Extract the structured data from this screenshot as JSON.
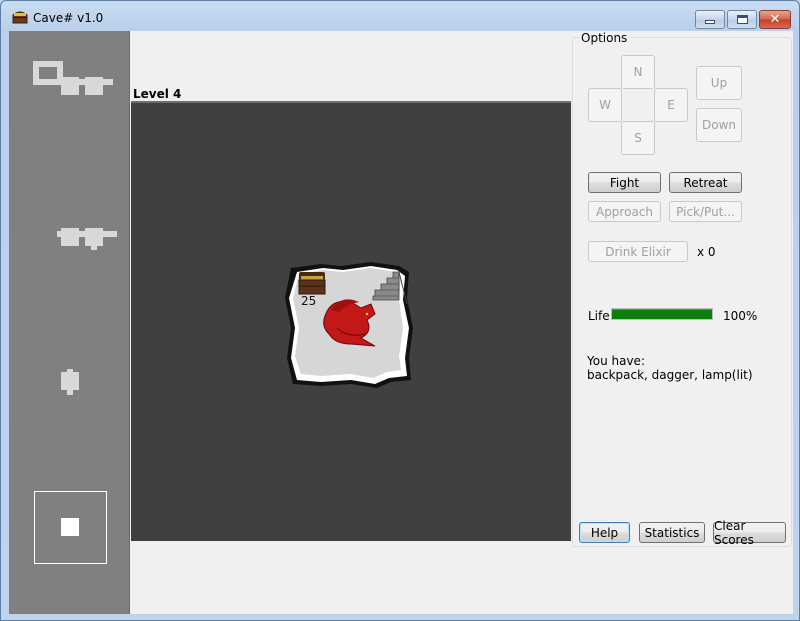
{
  "window": {
    "title": "Cave# v1.0",
    "icon": "treasure-chest-icon",
    "controls": {
      "minimize": "minimize-icon",
      "maximize": "maximize-icon",
      "close": "✕"
    }
  },
  "game": {
    "level_label": "Level 4",
    "room": {
      "items": [
        "treasure-chest",
        "staircase",
        "red-dragon"
      ],
      "gold_count": "25"
    }
  },
  "options": {
    "legend": "Options",
    "directions": {
      "north": "N",
      "west": "W",
      "east": "E",
      "south": "S"
    },
    "vertical": {
      "up": "Up",
      "down": "Down"
    },
    "actions": {
      "fight": "Fight",
      "retreat": "Retreat",
      "approach": "Approach",
      "pick_put": "Pick/Put...",
      "drink_elixir": "Drink Elixir",
      "elixir_count": "x 0"
    },
    "life": {
      "label": "Life:",
      "percent_text": "100%",
      "value": 100,
      "color": "#0b7e0b"
    },
    "inventory": {
      "heading": "You have:",
      "items_text": "backpack, dagger, lamp(lit)"
    },
    "footer": {
      "help": "Help",
      "statistics": "Statistics",
      "clear_scores": "Clear Scores"
    }
  }
}
